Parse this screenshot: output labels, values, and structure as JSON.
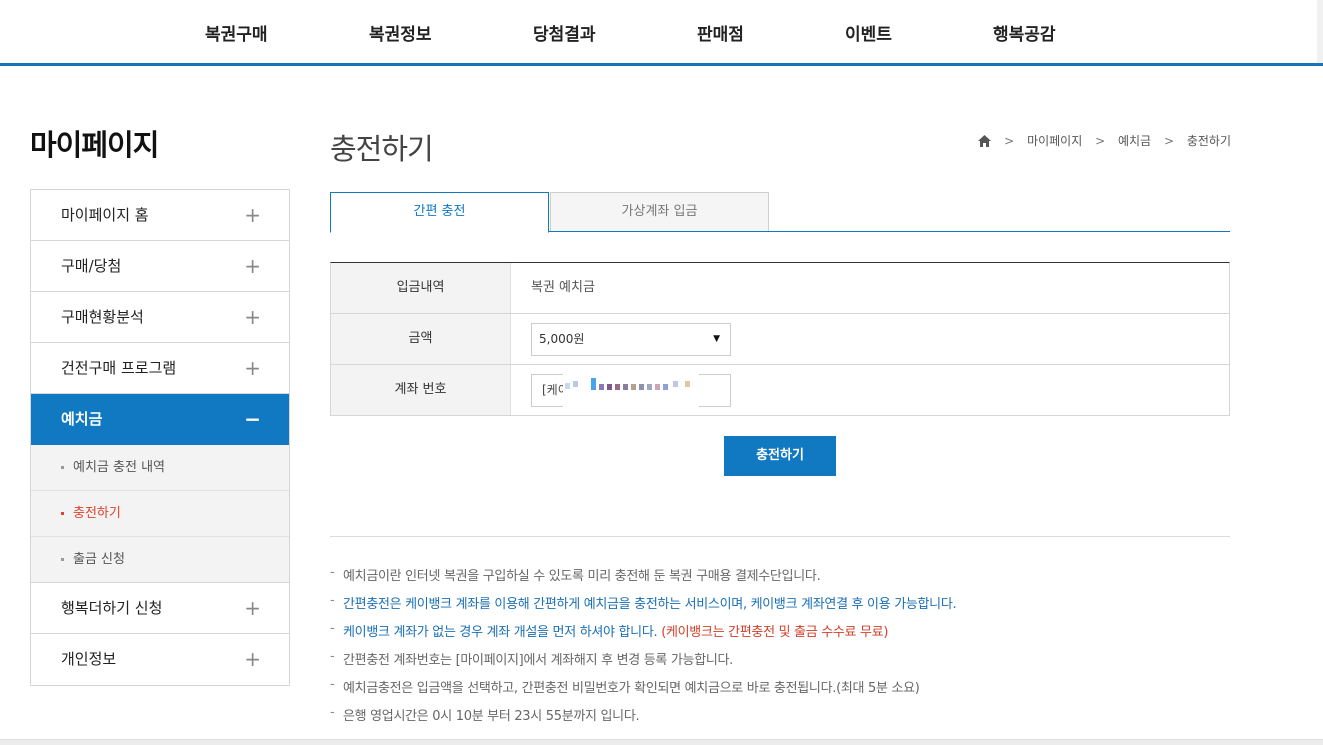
{
  "topnav": {
    "items": [
      "복권구매",
      "복권정보",
      "당첨결과",
      "판매점",
      "이벤트",
      "행복공감"
    ]
  },
  "sidebar": {
    "title": "마이페이지",
    "items": [
      {
        "label": "마이페이지 홈",
        "sign": "+"
      },
      {
        "label": "구매/당첨",
        "sign": "+"
      },
      {
        "label": "구매현황분석",
        "sign": "+"
      },
      {
        "label": "건전구매 프로그램",
        "sign": "+"
      },
      {
        "label": "예치금",
        "sign": "−"
      },
      {
        "label": "행복더하기 신청",
        "sign": "+"
      },
      {
        "label": "개인정보",
        "sign": "+"
      }
    ],
    "subitems": [
      "예치금 충전 내역",
      "충전하기",
      "출금 신청"
    ]
  },
  "main": {
    "title": "충전하기",
    "breadcrumb": [
      "마이페이지",
      "예치금",
      "충전하기"
    ],
    "tabs": [
      "간편 충전",
      "가상계좌 입금"
    ],
    "form": {
      "row1_label": "입금내역",
      "row1_value": "복권 예치금",
      "row2_label": "금액",
      "amount_selected": "5,000원",
      "row3_label": "계좌 번호",
      "account_prefix": "[케이"
    },
    "submit_label": "충전하기",
    "notes": [
      "예치금이란 인터넷 복권을 구입하실 수 있도록 미리 충전해 둔 복권 구매용 결제수단입니다.",
      "간편충전은 케이뱅크 계좌를 이용해 간편하게 예치금을 충전하는 서비스이며, 케이뱅크 계좌연결 후 이용 가능합니다.",
      "케이뱅크 계좌가 없는 경우 계좌 개설을 먼저 하셔야 합니다.",
      "(케이뱅크는 간편충전 및 출금 수수료 무료)",
      "간편충전 계좌번호는 [마이페이지]에서 계좌해지 후 변경 등록 가능합니다.",
      "예치금충전은 입금액을 선택하고, 간편충전 비밀번호가 확인되면 예치금으로 바로 충전됩니다.(최대 5분 소요)",
      "은행 영업시간은 0시 10분 부터 23시 55분까지 입니다."
    ]
  },
  "colors": {
    "accent": "#1178c2",
    "highlight_red": "#d9442c",
    "note_blue": "#1a6fb5"
  }
}
